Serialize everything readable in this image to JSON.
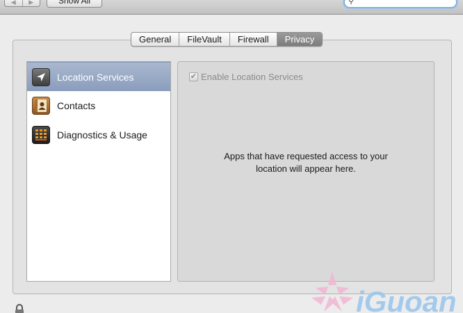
{
  "toolbar": {
    "back_icon": "back-arrow-icon",
    "forward_icon": "forward-arrow-icon",
    "show_all_label": "Show All",
    "search": {
      "value": "",
      "icon": "magnifier-icon"
    }
  },
  "tabs": [
    {
      "label": "General",
      "selected": false
    },
    {
      "label": "FileVault",
      "selected": false
    },
    {
      "label": "Firewall",
      "selected": false
    },
    {
      "label": "Privacy",
      "selected": true
    }
  ],
  "sidebar": {
    "items": [
      {
        "label": "Location Services",
        "icon": "location-arrow-icon",
        "selected": true
      },
      {
        "label": "Contacts",
        "icon": "address-book-icon",
        "selected": false
      },
      {
        "label": "Diagnostics & Usage",
        "icon": "console-grid-icon",
        "selected": false
      }
    ]
  },
  "panel": {
    "enable_label": "Enable Location Services",
    "enable_checked": true,
    "message_line1": "Apps that have requested access to your",
    "message_line2": "location will appear here."
  },
  "colors": {
    "selection": "#93a5c3",
    "selected_tab": "#8a8a8a",
    "window_bg": "#ececec"
  },
  "watermark": {
    "text": "iGuoan"
  }
}
